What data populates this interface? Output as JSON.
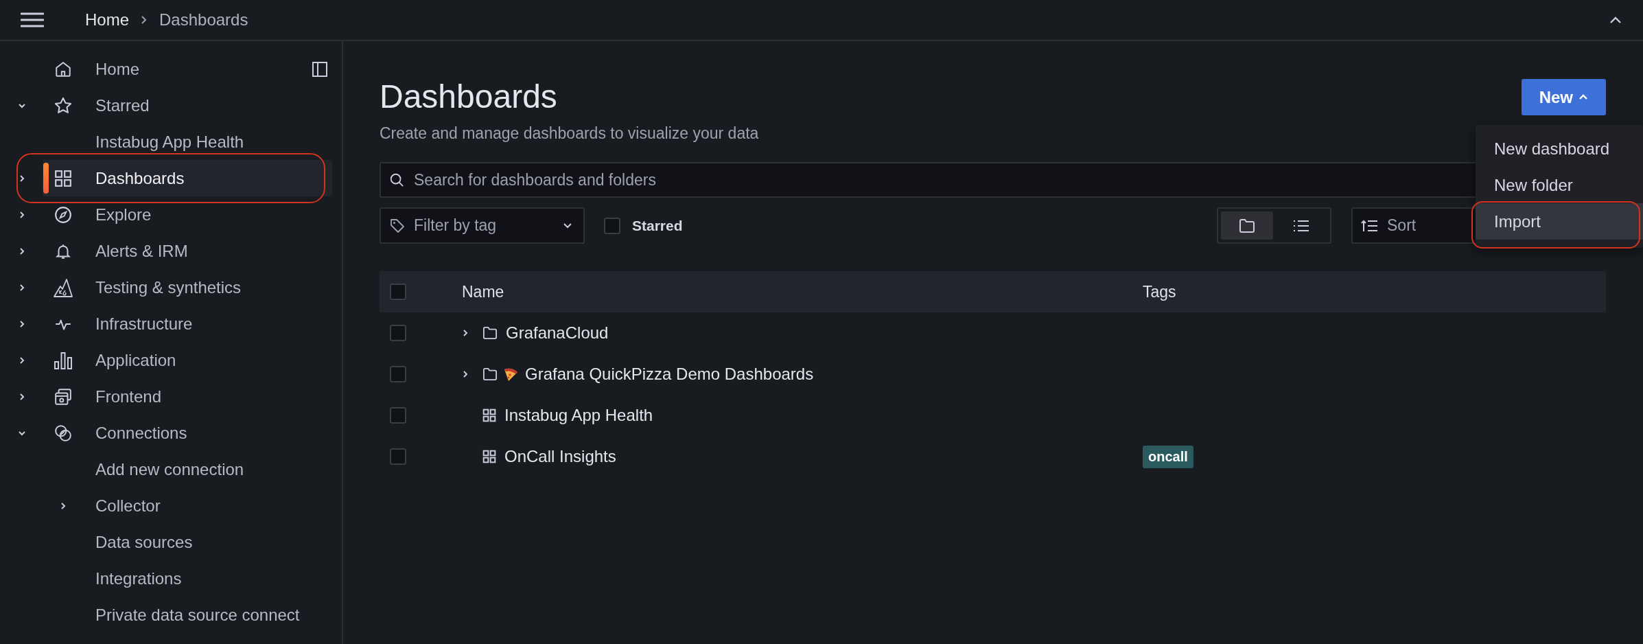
{
  "topbar": {
    "breadcrumbs": [
      {
        "label": "Home",
        "current": false
      },
      {
        "label": "Dashboards",
        "current": true
      }
    ]
  },
  "sidebar": {
    "items": [
      {
        "label": "Home",
        "selected": false
      },
      {
        "label": "Starred",
        "expanded": true,
        "selected": false,
        "children": [
          {
            "label": "Instabug App Health",
            "selected": false
          }
        ]
      },
      {
        "label": "Dashboards",
        "expanded": false,
        "selected": true,
        "annotated": true
      },
      {
        "label": "Explore",
        "expanded": false,
        "selected": false
      },
      {
        "label": "Alerts & IRM",
        "expanded": false,
        "selected": false
      },
      {
        "label": "Testing & synthetics",
        "expanded": false,
        "selected": false
      },
      {
        "label": "Infrastructure",
        "expanded": false,
        "selected": false
      },
      {
        "label": "Application",
        "expanded": false,
        "selected": false
      },
      {
        "label": "Frontend",
        "expanded": false,
        "selected": false
      },
      {
        "label": "Connections",
        "expanded": true,
        "selected": false,
        "children": [
          {
            "label": "Add new connection",
            "selected": false
          },
          {
            "label": "Collector",
            "expanded": false,
            "selected": false
          },
          {
            "label": "Data sources",
            "selected": false
          },
          {
            "label": "Integrations",
            "selected": false
          },
          {
            "label": "Private data source connect",
            "selected": false
          }
        ]
      }
    ]
  },
  "page": {
    "title": "Dashboards",
    "subtitle": "Create and manage dashboards to visualize your data",
    "new_button": {
      "label": "New",
      "expanded": true
    },
    "new_menu": [
      {
        "label": "New dashboard",
        "hovered": false
      },
      {
        "label": "New folder",
        "hovered": false
      },
      {
        "label": "Import",
        "hovered": true,
        "annotated": true
      }
    ],
    "search": {
      "placeholder": "Search for dashboards and folders"
    },
    "tag_filter": {
      "placeholder": "Filter by tag"
    },
    "starred_filter": {
      "label": "Starred",
      "checked": false
    },
    "view_toggle": [
      {
        "kind": "folder",
        "selected": true
      },
      {
        "kind": "list",
        "selected": false
      }
    ],
    "sort": {
      "placeholder": "Sort"
    },
    "table": {
      "columns": [
        "Name",
        "Tags"
      ],
      "all_checked": false,
      "rows": [
        {
          "kind": "folder",
          "name": "GrafanaCloud",
          "checked": false,
          "expanded": false,
          "tags": []
        },
        {
          "kind": "folder",
          "name": "Grafana QuickPizza Demo Dashboards",
          "checked": false,
          "expanded": false,
          "tags": []
        },
        {
          "kind": "dashboard",
          "name": "Instabug App Health",
          "checked": false,
          "tags": []
        },
        {
          "kind": "dashboard",
          "name": "OnCall Insights",
          "checked": false,
          "tags": [
            {
              "label": "oncall",
              "color": "#2b5a5e"
            }
          ]
        }
      ]
    }
  }
}
